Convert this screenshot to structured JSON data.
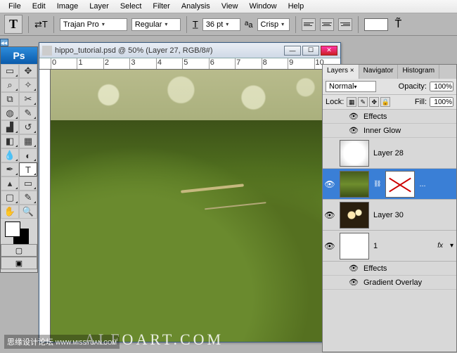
{
  "menu": {
    "items": [
      "File",
      "Edit",
      "Image",
      "Layer",
      "Select",
      "Filter",
      "Analysis",
      "View",
      "Window",
      "Help"
    ]
  },
  "options": {
    "font_family": "Trajan Pro",
    "font_style": "Regular",
    "font_size": "36 pt",
    "aa_label": "Crisp"
  },
  "app_logo": "Ps",
  "doc": {
    "title": "hippo_tutorial.psd @ 50% (Layer 27, RGB/8#)",
    "ruler_marks": [
      "0",
      "1",
      "2",
      "3",
      "4",
      "5",
      "6",
      "7",
      "8",
      "9",
      "10"
    ]
  },
  "panel": {
    "tabs": [
      "Layers",
      "Navigator",
      "Histogram"
    ],
    "blend_mode": "Normal",
    "opacity_label": "Opacity:",
    "opacity_value": "100%",
    "lock_label": "Lock:",
    "fill_label": "Fill:",
    "fill_value": "100%",
    "effects_label": "Effects",
    "inner_glow": "Inner Glow",
    "gradient_overlay": "Gradient Overlay",
    "layers": {
      "l28": "Layer 28",
      "l30": "Layer 30",
      "l1": "1",
      "ellipsis": "...",
      "fx": "fx"
    }
  },
  "watermark": "ALFOART.COM",
  "watermark2_a": "思缘设计论坛",
  "watermark2_b": "WWW.MISSYUAN.COM"
}
